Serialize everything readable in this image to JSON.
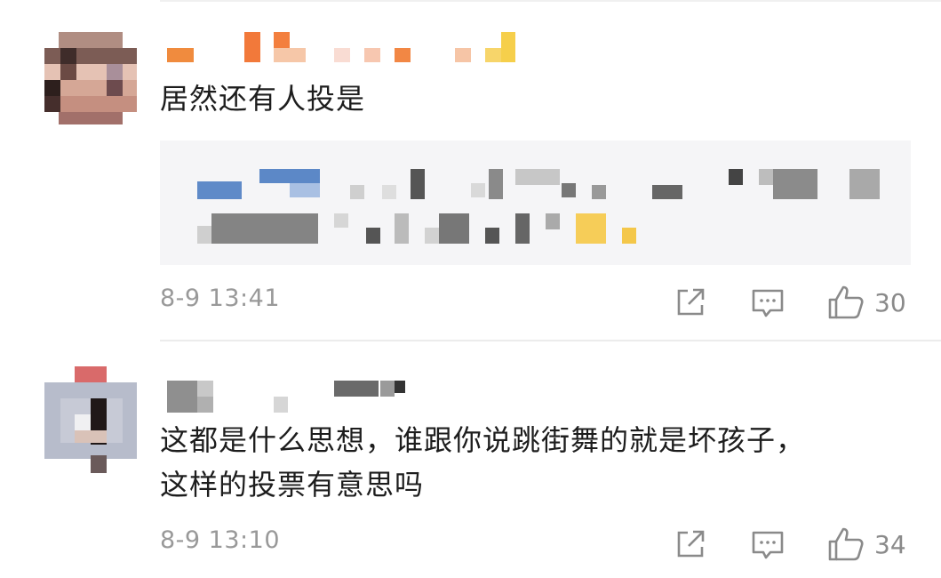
{
  "comments": [
    {
      "text": "居然还有人投是",
      "timestamp": "8-9 13:41",
      "likes": "30",
      "has_quote": true
    },
    {
      "text": "这都是什么思想，谁跟你说跳街舞的就是坏孩子，\n这样的投票有意思吗",
      "timestamp": "8-9 13:10",
      "likes": "34",
      "has_quote": false
    }
  ],
  "icons": {
    "share": "share-icon",
    "reply": "comment-icon",
    "like": "thumbs-up-icon"
  },
  "colors": {
    "text": "#1d1d1d",
    "meta": "#999999",
    "quote_bg": "#f5f5f7",
    "icon": "#8a8a8a"
  }
}
